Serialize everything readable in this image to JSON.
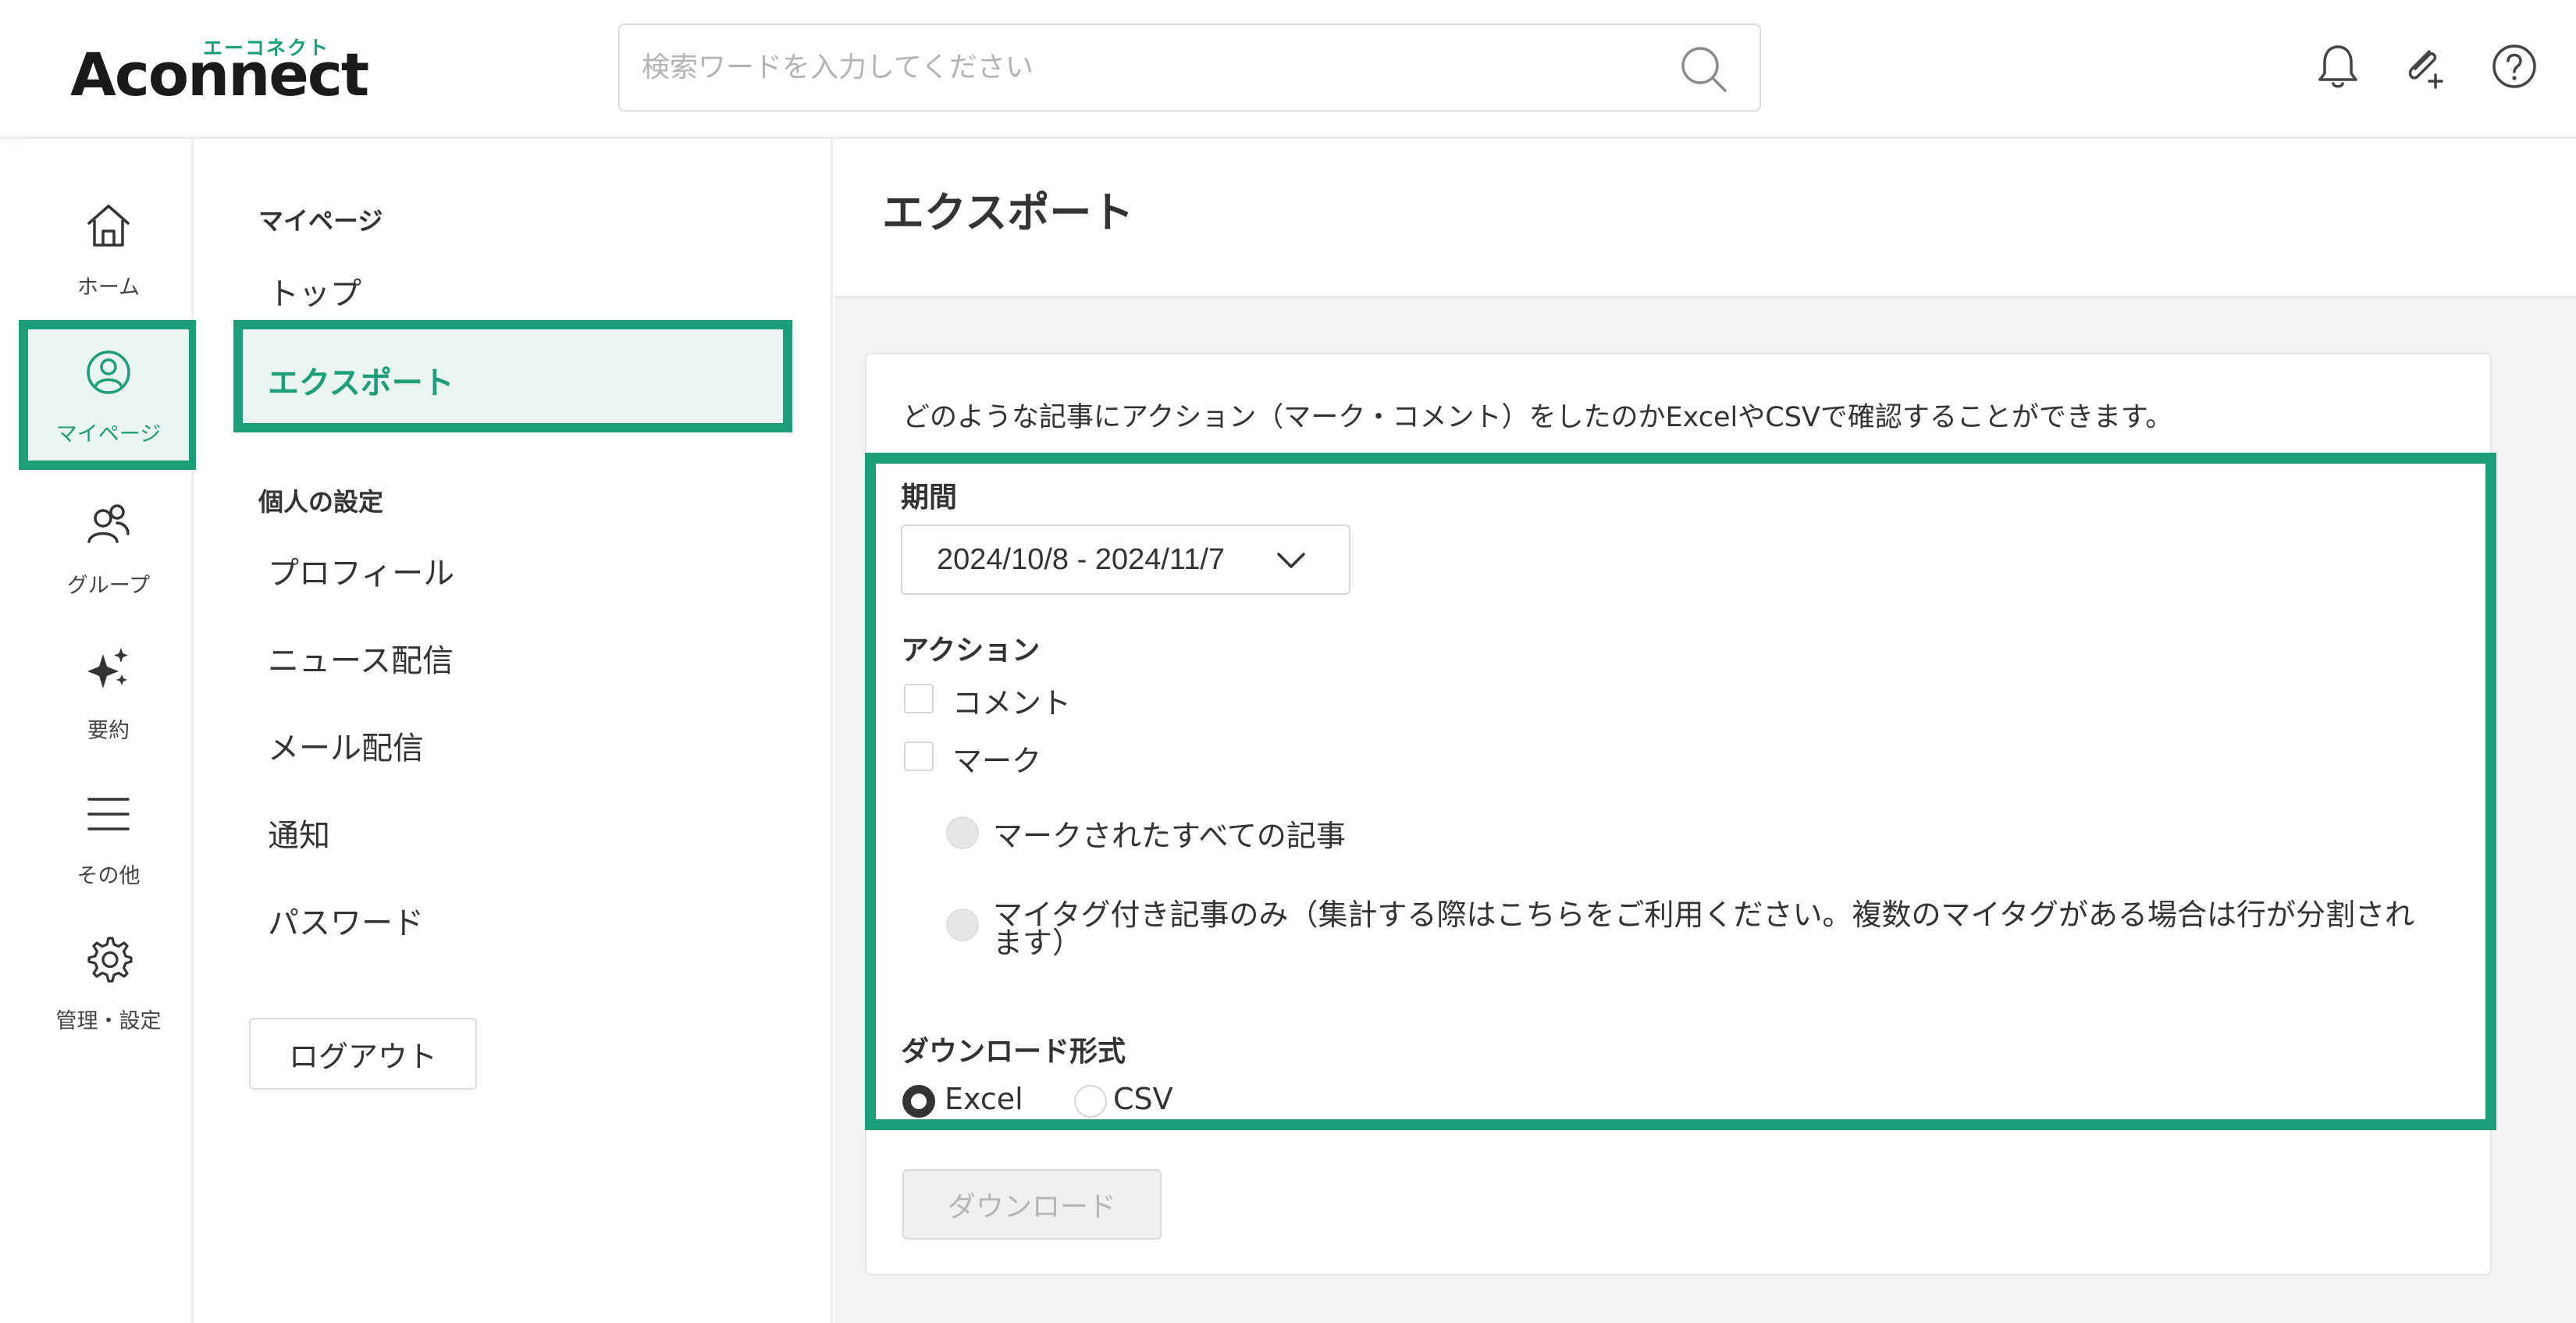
{
  "app": {
    "logo_ruby": "エーコネクト",
    "logo_text": "Aconnect",
    "accent_color": "#1c9e79"
  },
  "search": {
    "placeholder": "検索ワードを入力してください",
    "value": "",
    "icon": "search-icon"
  },
  "header_icons": [
    {
      "name": "bell-icon"
    },
    {
      "name": "paperclip-plus-icon"
    },
    {
      "name": "help-icon"
    }
  ],
  "rail": {
    "items": [
      {
        "label": "ホーム",
        "icon": "home-icon",
        "active": false
      },
      {
        "label": "マイページ",
        "icon": "user-circle-icon",
        "active": true
      },
      {
        "label": "グループ",
        "icon": "group-icon",
        "active": false
      },
      {
        "label": "要約",
        "icon": "sparkle-icon",
        "active": false
      },
      {
        "label": "その他",
        "icon": "menu-icon",
        "active": false
      },
      {
        "label": "管理・設定",
        "icon": "gear-icon",
        "active": false
      }
    ]
  },
  "subnav": {
    "section1_title": "マイページ",
    "section1_items": [
      "トップ",
      "エクスポート"
    ],
    "active_item": "エクスポート",
    "section2_title": "個人の設定",
    "section2_items": [
      "プロフィール",
      "ニュース配信",
      "メール配信",
      "通知",
      "パスワード"
    ],
    "logout_label": "ログアウト"
  },
  "main": {
    "title": "エクスポート",
    "description": "どのような記事にアクション（マーク・コメント）をしたのかExcelやCSVで確認することができます。",
    "period": {
      "label": "期間",
      "value": "2024/10/8 - 2024/11/7"
    },
    "action": {
      "label": "アクション",
      "options": [
        {
          "label": "コメント",
          "checked": false
        },
        {
          "label": "マーク",
          "checked": false
        }
      ],
      "mark_sub_options": [
        {
          "label": "マークされたすべての記事",
          "disabled": true
        },
        {
          "label": "マイタグ付き記事のみ（集計する際はこちらをご利用ください。複数のマイタグがある場合は行が分割されます）",
          "disabled": true
        }
      ]
    },
    "format": {
      "label": "ダウンロード形式",
      "options": [
        {
          "label": "Excel",
          "selected": true
        },
        {
          "label": "CSV",
          "selected": false
        }
      ]
    },
    "download_label": "ダウンロード"
  }
}
